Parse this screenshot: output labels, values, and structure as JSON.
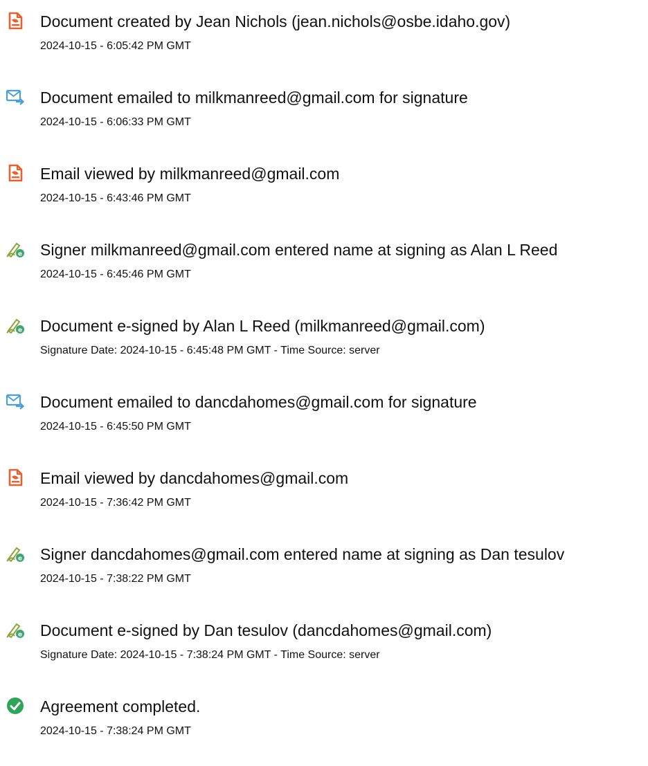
{
  "colors": {
    "document_icon": "#e8602c",
    "email_icon": "#4a9fd9",
    "sign_icon": "#8aa63a",
    "sign_badge": "#3aa86b",
    "complete_icon": "#2fa55a"
  },
  "events": [
    {
      "icon": "document-icon",
      "title": "Document created by Jean Nichols (jean.nichols@osbe.idaho.gov)",
      "detail": "2024-10-15 - 6:05:42 PM GMT"
    },
    {
      "icon": "email-sent-icon",
      "title": "Document emailed to milkmanreed@gmail.com for signature",
      "detail": "2024-10-15 - 6:06:33 PM GMT"
    },
    {
      "icon": "document-icon",
      "title": "Email viewed by milkmanreed@gmail.com",
      "detail": "2024-10-15 - 6:43:46 PM GMT"
    },
    {
      "icon": "e-sign-icon",
      "title": "Signer milkmanreed@gmail.com entered name at signing as Alan L Reed",
      "detail": "2024-10-15 - 6:45:46 PM GMT"
    },
    {
      "icon": "e-sign-icon",
      "title": "Document e-signed by Alan L Reed (milkmanreed@gmail.com)",
      "detail": "Signature Date: 2024-10-15 - 6:45:48 PM GMT - Time Source: server"
    },
    {
      "icon": "email-sent-icon",
      "title": "Document emailed to dancdahomes@gmail.com for signature",
      "detail": "2024-10-15 - 6:45:50 PM GMT"
    },
    {
      "icon": "document-icon",
      "title": "Email viewed by dancdahomes@gmail.com",
      "detail": "2024-10-15 - 7:36:42 PM GMT"
    },
    {
      "icon": "e-sign-icon",
      "title": "Signer dancdahomes@gmail.com entered name at signing as Dan tesulov",
      "detail": "2024-10-15 - 7:38:22 PM GMT"
    },
    {
      "icon": "e-sign-icon",
      "title": "Document e-signed by Dan tesulov (dancdahomes@gmail.com)",
      "detail": "Signature Date: 2024-10-15 - 7:38:24 PM GMT - Time Source: server"
    },
    {
      "icon": "checkmark-circle-icon",
      "title": "Agreement completed.",
      "detail": "2024-10-15 - 7:38:24 PM GMT"
    }
  ]
}
